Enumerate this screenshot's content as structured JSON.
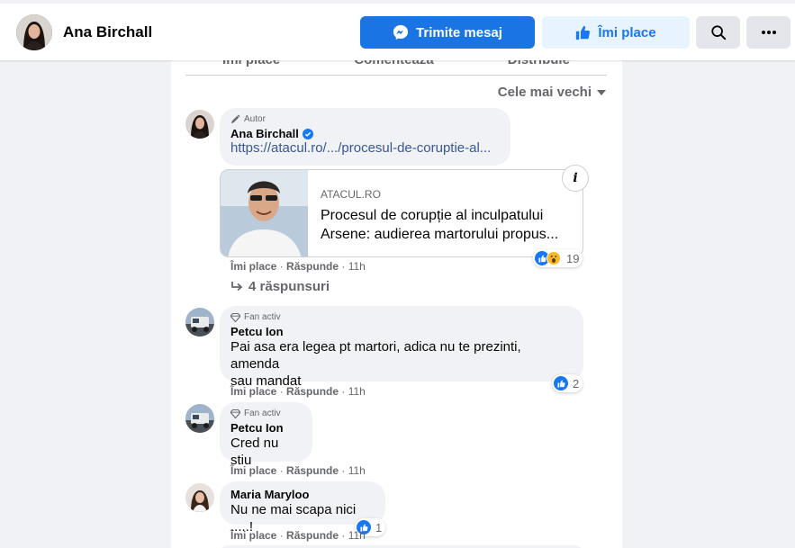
{
  "header": {
    "page_name": "Ana Birchall",
    "message_button": "Trimite mesaj",
    "like_button": "Îmi place"
  },
  "post": {
    "actions": [
      "Îmi place",
      "Comentează",
      "Distribuie"
    ],
    "sort_label": "Cele mai vechi"
  },
  "comments": [
    {
      "badge": "Autor",
      "author": "Ana Birchall",
      "verified": true,
      "text": "https://atacul.ro/.../procesul-de-coruptie-al...",
      "link_card": {
        "domain": "ATACUL.RO",
        "title_line1": "Procesul de corupție al inculpatului",
        "title_line2": "Arsene: audierea martorului propus..."
      },
      "meta": {
        "like": "Îmi place",
        "reply": "Răspunde",
        "time": "11h"
      },
      "reactions": "19",
      "replies_label": "4 răspunsuri"
    },
    {
      "badge": "Fan activ",
      "author": "Petcu Ion",
      "text_line1": "Pai asa era legea pt martori, adica nu te prezinti, amenda",
      "text_line2": "sau mandat",
      "meta": {
        "like": "Îmi place",
        "reply": "Răspunde",
        "time": "11h"
      },
      "reactions": "2"
    },
    {
      "badge": "Fan activ",
      "author": "Petcu Ion",
      "text": "Cred nu stiu",
      "meta": {
        "like": "Îmi place",
        "reply": "Răspunde",
        "time": "11h"
      }
    },
    {
      "author": "Maria Maryloo",
      "text": "Nu ne mai scapa nici .....!",
      "meta": {
        "like": "Îmi place",
        "reply": "Răspunde",
        "time": "11h"
      },
      "reactions": "1"
    }
  ],
  "colors": {
    "primary": "#1b74e4",
    "like_bg": "#e7f3ff",
    "bubble": "#f0f2f5",
    "muted_text": "#65676b",
    "link": "#385898"
  }
}
